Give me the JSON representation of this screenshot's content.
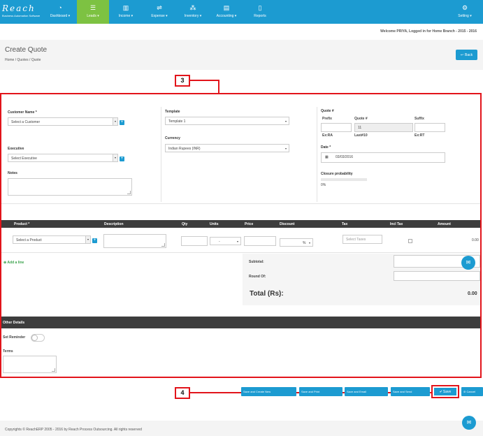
{
  "brand": {
    "name": "Reach",
    "tagline": "Business Automation Software"
  },
  "nav": {
    "items": [
      {
        "key": "dashboard",
        "label": "Dashboard ▾",
        "icon": "dashboard-icon"
      },
      {
        "key": "leads",
        "label": "Leads ▾",
        "icon": "leads-icon",
        "active": true
      },
      {
        "key": "income",
        "label": "Income ▾",
        "icon": "income-icon"
      },
      {
        "key": "expense",
        "label": "Expense ▾",
        "icon": "expense-icon"
      },
      {
        "key": "inventory",
        "label": "Inventory ▾",
        "icon": "inventory-icon"
      },
      {
        "key": "accounting",
        "label": "Accounting ▾",
        "icon": "accounting-icon"
      },
      {
        "key": "reports",
        "label": "Reports",
        "icon": "reports-icon"
      }
    ],
    "settings_label": "Setting ▾"
  },
  "welcome": "Welcome PRIYA, Logged in for Home Branch - 2015 - 2016",
  "page": {
    "title": "Create Quote",
    "breadcrumb": [
      "Home",
      "Quotes",
      "Quote"
    ],
    "back_label": "Back"
  },
  "form": {
    "customer_name_label": "Customer Name *",
    "customer_placeholder": "Select a Customer",
    "executive_label": "Executive",
    "executive_placeholder": "Select Executive",
    "notes_label": "Notes",
    "template_label": "Template",
    "template_value": "Template 1",
    "currency_label": "Currency",
    "currency_value": "Indian Rupees (INR)",
    "quote_label": "Quote #",
    "prefix_label": "Prefix",
    "quote_no_label": "Quote #",
    "suffix_label": "Suffix",
    "quote_no_value": "11",
    "prefix_hint": "Ex:RA",
    "quote_hint": "Last#10",
    "suffix_hint": "Ex:RT",
    "date_label": "Date *",
    "date_value": "03/03/2016",
    "closure_label": "Closure probability",
    "closure_value": "0%"
  },
  "items_table": {
    "columns": [
      "Product *",
      "Description",
      "Qty",
      "Units",
      "Price",
      "Discount",
      "Tax",
      "Incl Tax",
      "Amount"
    ],
    "row": {
      "product_placeholder": "Select a Product",
      "units_value": "-",
      "discount_unit": "%",
      "tax_placeholder": "Select Taxes",
      "amount": "0.00"
    },
    "add_line": "Add a line"
  },
  "summary": {
    "subtotal_label": "Subtotal:",
    "round_off_label": "Round Of:",
    "total_label": "Total (Rs):",
    "total_value": "0.00"
  },
  "other": {
    "section_title": "Other Details",
    "set_reminder_label": "Set Reminder",
    "terms_label": "Terms"
  },
  "actions": [
    "Save and Create New",
    "Save and Print",
    "Save and Email",
    "Save and Send"
  ],
  "save_label": "Save",
  "cancel_label": "Cancel",
  "annotations": {
    "form_area": "3",
    "save_area": "4"
  },
  "footer": "Copyrights © ReachERP 2005 - 2016 by Reach Process Outsourcing. All rights reserved",
  "colors": {
    "primary": "#1c9bd1",
    "active_nav": "#7dc242",
    "annotation": "#e2141b",
    "table_header": "#3d3d3d"
  }
}
